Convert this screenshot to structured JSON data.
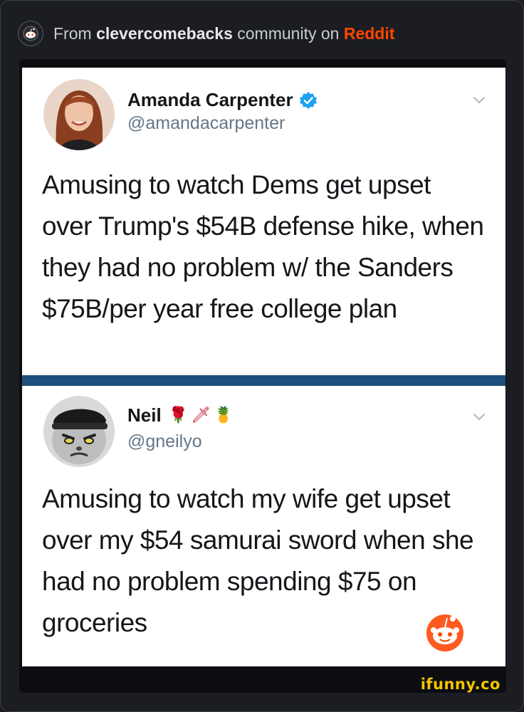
{
  "header": {
    "prefix": "From ",
    "community": "clevercomebacks",
    "middle": " community on ",
    "brand": "Reddit",
    "icon": "reddit-logo-icon"
  },
  "tweets": [
    {
      "name": "Amanda Carpenter",
      "handle": "@amandacarpenter",
      "verified": true,
      "emojis": "",
      "text": "Amusing to watch Dems get upset over Trump's $54B defense hike, when they had no problem w/ the Sanders $75B/per year free college plan"
    },
    {
      "name": "Neil",
      "handle": "@gneilyo",
      "verified": false,
      "emojis": "🌹🗡🍍",
      "text": "Amusing to watch my wife get upset over my $54 samurai sword when she had no problem spending $75 on groceries"
    }
  ],
  "watermark": "ifunny.co",
  "colors": {
    "background": "#1b1d22",
    "reddit_orange": "#ff4500",
    "twitter_blue": "#1da1f2",
    "divider_blue": "#1f4f7c",
    "ifunny_yellow": "#f5c400"
  }
}
